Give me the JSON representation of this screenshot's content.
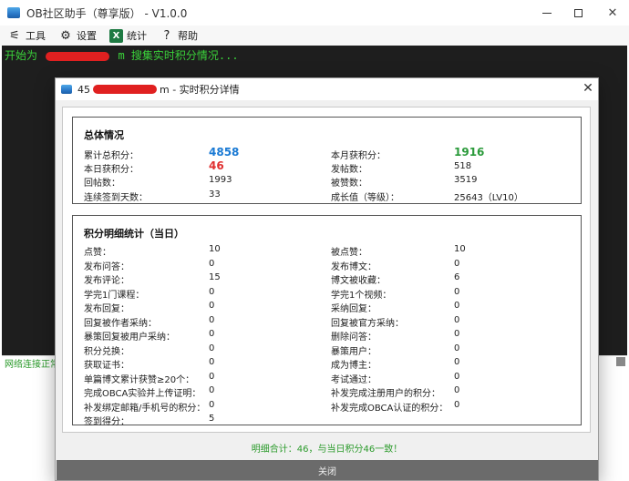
{
  "main_window": {
    "title": "OB社区助手（尊享版） - V1.0.0",
    "menu": [
      {
        "label": "工具",
        "icon": "tools-icon"
      },
      {
        "label": "设置",
        "icon": "gear-icon"
      },
      {
        "label": "统计",
        "icon": "excel-icon"
      },
      {
        "label": "帮助",
        "icon": "help-icon"
      }
    ],
    "console_prefix": "开始为",
    "console_suffix": "m 搜集实时积分情况...",
    "status_text": "网络连接正常"
  },
  "dialog": {
    "title_prefix": "45",
    "title_suffix": "m - 实时积分详情",
    "close_x": "✕",
    "overview": {
      "title": "总体情况",
      "rows": [
        {
          "left_label": "累计总积分：",
          "left_value": "4858",
          "right_label": "本月获积分：",
          "right_value": "1916"
        },
        {
          "left_label": "本日获积分：",
          "left_value": "46",
          "right_label": "发帖数：",
          "right_value": "518"
        },
        {
          "left_label": "回帖数：",
          "left_value": "1993",
          "right_label": "被赞数：",
          "right_value": "3519"
        },
        {
          "left_label": "连续签到天数：",
          "left_value": "33",
          "right_label": "成长值（等级）：",
          "right_value": "25643（LV10）"
        }
      ]
    },
    "detail": {
      "title": "积分明细统计（当日）",
      "rows": [
        {
          "left_label": "点赞：",
          "left_value": "10",
          "right_label": "被点赞：",
          "right_value": "10"
        },
        {
          "left_label": "发布问答：",
          "left_value": "0",
          "right_label": "发布博文：",
          "right_value": "0"
        },
        {
          "left_label": "发布评论：",
          "left_value": "15",
          "right_label": "博文被收藏：",
          "right_value": "6"
        },
        {
          "left_label": "学完1门课程：",
          "left_value": "0",
          "right_label": "学完1个视频：",
          "right_value": "0"
        },
        {
          "left_label": "发布回复：",
          "left_value": "0",
          "right_label": "采纳回复：",
          "right_value": "0"
        },
        {
          "left_label": "回复被作者采纳：",
          "left_value": "0",
          "right_label": "回复被官方采纳：",
          "right_value": "0"
        },
        {
          "left_label": "暴策回复被用户采纳：",
          "left_value": "0",
          "right_label": "删除问答：",
          "right_value": "0"
        },
        {
          "left_label": "积分兑换：",
          "left_value": "0",
          "right_label": "暴策用户：",
          "right_value": "0"
        },
        {
          "left_label": "获取证书：",
          "left_value": "0",
          "right_label": "成为博主：",
          "right_value": "0"
        },
        {
          "left_label": "单篇博文累计获赞≥20个：",
          "left_value": "0",
          "right_label": "考试通过：",
          "right_value": "0"
        },
        {
          "left_label": "完成OBCA实验并上传证明：",
          "left_value": "0",
          "right_label": "补发完成注册用户的积分：",
          "right_value": "0"
        },
        {
          "left_label": "补发绑定邮箱/手机号的积分：",
          "left_value": "0",
          "right_label": "补发完成OBCA认证的积分：",
          "right_value": "0"
        },
        {
          "left_label": "签到得分：",
          "left_value": "5",
          "right_label": "",
          "right_value": ""
        }
      ]
    },
    "summary": "明细合计：46，与当日积分46一致！",
    "close_button": "关闭"
  },
  "colors": {
    "accent_blue": "#1a7ad4",
    "accent_red": "#e03030",
    "accent_green": "#2a9a3a",
    "console_green": "#3ad13a"
  }
}
